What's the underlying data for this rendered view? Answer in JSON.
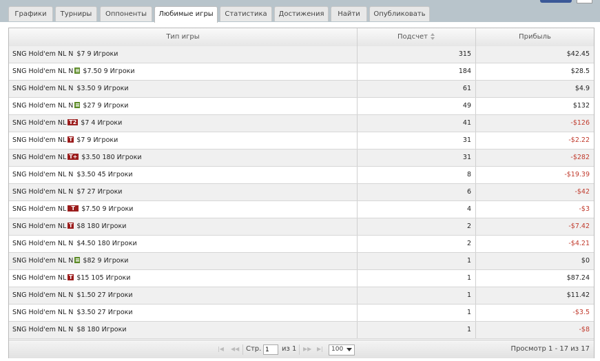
{
  "tabs": [
    {
      "label": "Графики",
      "active": false
    },
    {
      "label": "Турниры",
      "active": false
    },
    {
      "label": "Оппоненты",
      "active": false
    },
    {
      "label": "Любимые игры",
      "active": true
    },
    {
      "label": "Статистика",
      "active": false
    },
    {
      "label": "Достижения",
      "active": false
    },
    {
      "label": "Найти",
      "active": false
    },
    {
      "label": "Опубликовать",
      "active": false
    }
  ],
  "table": {
    "columns": {
      "game_type": "Тип игры",
      "count": "Подсчет",
      "profit": "Прибыль"
    },
    "rows": [
      {
        "prefix": "SNG Hold'em NL N",
        "badge": "",
        "suffix": "$7 9 Игроки",
        "count": "315",
        "profit": "$42.45",
        "negative": false
      },
      {
        "prefix": "SNG Hold'em NL N",
        "badge": "s",
        "suffix": "$7.50 9 Игроки",
        "count": "184",
        "profit": "$28.5",
        "negative": false
      },
      {
        "prefix": "SNG Hold'em NL N",
        "badge": "",
        "suffix": "$3.50 9 Игроки",
        "count": "61",
        "profit": "$4.9",
        "negative": false
      },
      {
        "prefix": "SNG Hold'em NL N",
        "badge": "s",
        "suffix": "$27 9 Игроки",
        "count": "49",
        "profit": "$132",
        "negative": false
      },
      {
        "prefix": "SNG Hold'em NL",
        "badge": "t2",
        "suffix": "$7 4 Игроки",
        "count": "41",
        "profit": "-$126",
        "negative": true
      },
      {
        "prefix": "SNG Hold'em NL",
        "badge": "t",
        "suffix": "$7 9 Игроки",
        "count": "31",
        "profit": "-$2.22",
        "negative": true
      },
      {
        "prefix": "SNG Hold'em NL",
        "badge": "tplus",
        "suffix": "$3.50 180 Игроки",
        "count": "31",
        "profit": "-$282",
        "negative": true
      },
      {
        "prefix": "SNG Hold'em NL N",
        "badge": "",
        "suffix": "$3.50 45 Игроки",
        "count": "8",
        "profit": "-$19.39",
        "negative": true
      },
      {
        "prefix": "SNG Hold'em NL N",
        "badge": "",
        "suffix": "$7 27 Игроки",
        "count": "6",
        "profit": "-$42",
        "negative": true
      },
      {
        "prefix": "SNG Hold'em NL",
        "badge": "ts",
        "suffix": "$7.50 9 Игроки",
        "count": "4",
        "profit": "-$3",
        "negative": true
      },
      {
        "prefix": "SNG Hold'em NL",
        "badge": "t",
        "suffix": "$8 180 Игроки",
        "count": "2",
        "profit": "-$7.42",
        "negative": true
      },
      {
        "prefix": "SNG Hold'em NL N",
        "badge": "",
        "suffix": "$4.50 180 Игроки",
        "count": "2",
        "profit": "-$4.21",
        "negative": true
      },
      {
        "prefix": "SNG Hold'em NL N",
        "badge": "s",
        "suffix": "$82 9 Игроки",
        "count": "1",
        "profit": "$0",
        "negative": false
      },
      {
        "prefix": "SNG Hold'em NL",
        "badge": "t",
        "suffix": "$15 105 Игроки",
        "count": "1",
        "profit": "$87.24",
        "negative": false
      },
      {
        "prefix": "SNG Hold'em NL N",
        "badge": "",
        "suffix": "$1.50 27 Игроки",
        "count": "1",
        "profit": "$11.42",
        "negative": false
      },
      {
        "prefix": "SNG Hold'em NL N",
        "badge": "",
        "suffix": "$3.50 27 Игроки",
        "count": "1",
        "profit": "-$3.5",
        "negative": true
      },
      {
        "prefix": "SNG Hold'em NL N",
        "badge": "",
        "suffix": "$8 180 Игроки",
        "count": "1",
        "profit": "-$8",
        "negative": true
      }
    ]
  },
  "badges": {
    "t": "T",
    "t2": "T2",
    "tplus": "T+",
    "s": "≡",
    "ts": "T"
  },
  "pager": {
    "page_label": "Стр.",
    "page_value": "1",
    "of_label": "из 1",
    "per_page": "100",
    "summary": "Просмотр 1 - 17 из 17"
  },
  "colors": {
    "negative": "#c0392b",
    "topbar": "#b8c4cb",
    "facebook": "#3b5998"
  }
}
